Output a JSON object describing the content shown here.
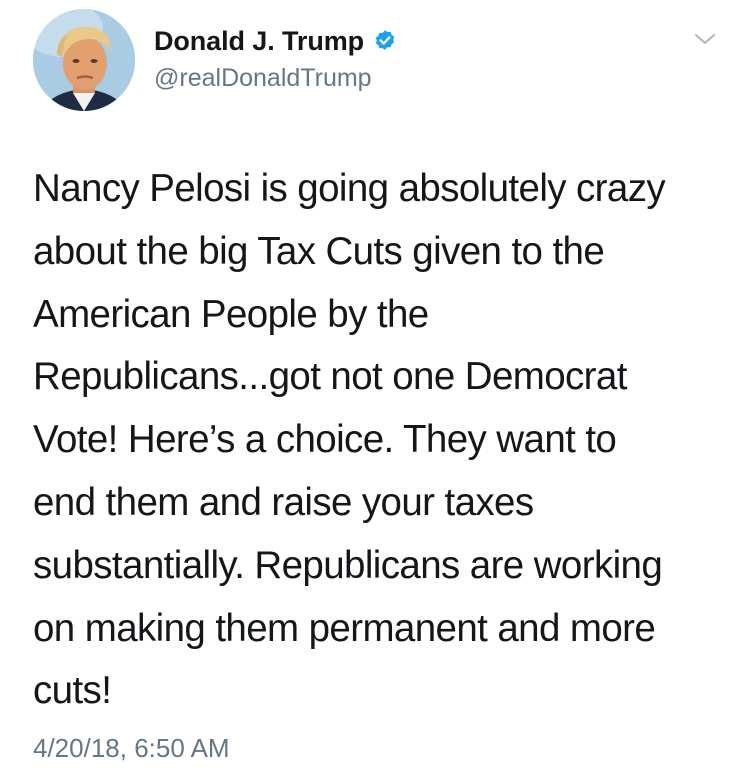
{
  "author": {
    "display_name": "Donald J. Trump",
    "handle": "@realDonaldTrump",
    "verified": true,
    "avatar_icon": "profile-photo"
  },
  "tweet": {
    "text_lines": [
      "Nancy Pelosi is going absolutely crazy",
      "about the big Tax Cuts given to the",
      "American People by the",
      "Republicans...got not one Democrat",
      "Vote! Here’s a choice. They want to",
      "end them and raise your taxes",
      "substantially. Republicans are working",
      "on making them permanent and more",
      "cuts!"
    ],
    "timestamp": "4/20/18, 6:50 AM"
  },
  "icons": {
    "verified": "verified-badge-icon",
    "menu": "chevron-down-icon"
  },
  "colors": {
    "text": "#14171a",
    "secondary_text": "#657786",
    "verified_blue": "#1da1f2",
    "chevron": "#aab8c2",
    "background": "#ffffff"
  }
}
